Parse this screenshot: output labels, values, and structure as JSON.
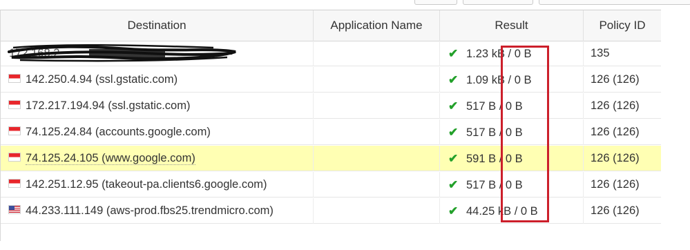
{
  "table": {
    "columns": {
      "destination": "Destination",
      "application": "Application Name",
      "result": "Result",
      "policy": "Policy ID"
    },
    "rows": [
      {
        "flag": "",
        "destination": "172.168.2",
        "application": "",
        "result": "1.23 kB / 0 B",
        "policy": "135",
        "highlighted": false,
        "redacted": true
      },
      {
        "flag": "sg",
        "destination": "142.250.4.94 (ssl.gstatic.com)",
        "application": "",
        "result": "1.09 kB / 0 B",
        "policy": "126 (126)",
        "highlighted": false
      },
      {
        "flag": "sg",
        "destination": "172.217.194.94 (ssl.gstatic.com)",
        "application": "",
        "result": "517 B / 0 B",
        "policy": "126 (126)",
        "highlighted": false
      },
      {
        "flag": "sg",
        "destination": "74.125.24.84 (accounts.google.com)",
        "application": "",
        "result": "517 B / 0 B",
        "policy": "126 (126)",
        "highlighted": false
      },
      {
        "flag": "sg",
        "destination": "74.125.24.105 (www.google.com)",
        "application": "",
        "result": "591 B / 0 B",
        "policy": "126 (126)",
        "highlighted": true
      },
      {
        "flag": "sg",
        "destination": "142.251.12.95 (takeout-pa.clients6.google.com)",
        "application": "",
        "result": "517 B / 0 B",
        "policy": "126 (126)",
        "highlighted": false
      },
      {
        "flag": "us",
        "destination": "44.233.111.149 (aws-prod.fbs25.trendmicro.com)",
        "application": "",
        "result": "44.25 kB / 0 B",
        "policy": "126 (126)",
        "highlighted": false
      }
    ]
  },
  "icons": {
    "result_status": "check-icon",
    "country_flag": "flag-icon"
  },
  "colors": {
    "highlight_row": "#ffffb3",
    "check": "#22a02a",
    "annotation_box": "#cc1f2b"
  }
}
